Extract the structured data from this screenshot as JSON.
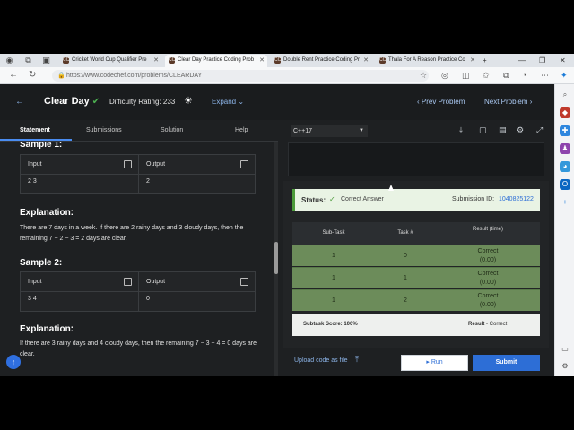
{
  "browser": {
    "tabs": [
      {
        "favicon": "CC",
        "title": "Cricket World Cup Qualifier Pre",
        "active": false
      },
      {
        "favicon": "CC",
        "title": "Clear Day Practice Coding Prob",
        "active": true
      },
      {
        "favicon": "CC",
        "title": "Double Rent Practice Coding Pr",
        "active": false
      },
      {
        "favicon": "CC",
        "title": "Thala For A Reason Practice Co",
        "active": false
      }
    ],
    "url": "https://www.codechef.com/problems/CLEARDAY",
    "icons": {
      "profile": "profile-icon",
      "workspaces": "workspaces-icon",
      "tab_actions": "tab-actions-icon"
    }
  },
  "header": {
    "title": "Clear Day",
    "difficulty": "Difficulty Rating: 233",
    "expand": "Expand",
    "prev": "Prev Problem",
    "next": "Next Problem"
  },
  "problem_tabs": [
    "Statement",
    "Submissions",
    "Solution",
    "Help"
  ],
  "samples": [
    {
      "heading": "Sample 1:",
      "input_label": "Input",
      "output_label": "Output",
      "input": "2 3",
      "output": "2",
      "explanation_heading": "Explanation:",
      "explanation": "There are 7 days in a week. If there are 2 rainy days and 3 cloudy days, then the remaining 7 − 2 − 3 = 2 days are clear."
    },
    {
      "heading": "Sample 2:",
      "input_label": "Input",
      "output_label": "Output",
      "input": "3 4",
      "output": "0",
      "explanation_heading": "Explanation:",
      "explanation": "If there are 3 rainy days and 4 cloudy days, then the remaining 7 − 3 − 4 = 0 days are clear."
    }
  ],
  "editor": {
    "language": "C++17"
  },
  "result": {
    "status_label": "Status:",
    "status": "Correct Answer",
    "submission_label": "Submission ID:",
    "submission_id": "1040825122",
    "table_headers": [
      "Sub-Task",
      "Task #",
      "Result (time)"
    ],
    "rows": [
      {
        "subtask": "1",
        "task": "0",
        "result": "Correct",
        "time": "(0.00)"
      },
      {
        "subtask": "1",
        "task": "1",
        "result": "Correct",
        "time": "(0.00)"
      },
      {
        "subtask": "1",
        "task": "2",
        "result": "Correct",
        "time": "(0.00)"
      }
    ],
    "subtask_score": "Subtask Score: 100%",
    "result_summary_label": "Result - ",
    "result_summary": "Correct"
  },
  "actions": {
    "upload": "Upload code as file",
    "run": "Run",
    "submit": "Submit"
  },
  "colors": {
    "accent": "#2d6ed6",
    "success": "#4c9a3a",
    "row_bg": "#6c8c5a"
  }
}
